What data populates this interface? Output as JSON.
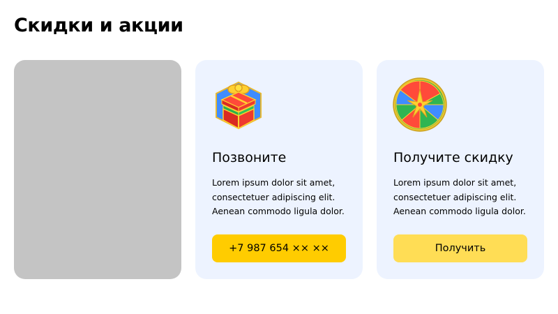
{
  "page": {
    "title": "Скидки и акции"
  },
  "cards": [
    {
      "type": "image-placeholder"
    },
    {
      "icon": "gift-box-icon",
      "title": "Позвоните",
      "text": "Lorem ipsum dolor sit amet, consectetuer adipiscing elit. Aenean commodo ligula dolor.",
      "button_label": "+7 987 654 ×× ××",
      "button_color": "#ffcc00"
    },
    {
      "icon": "fortune-wheel-icon",
      "title": "Получите скидку",
      "text": "Lorem ipsum dolor sit amet, consectetuer adipiscing elit. Aenean commodo ligula dolor.",
      "button_label": "Получить",
      "button_color": "#ffdd55"
    }
  ],
  "colors": {
    "card_background": "#edf3ff",
    "placeholder_background": "#c4c4c4"
  }
}
